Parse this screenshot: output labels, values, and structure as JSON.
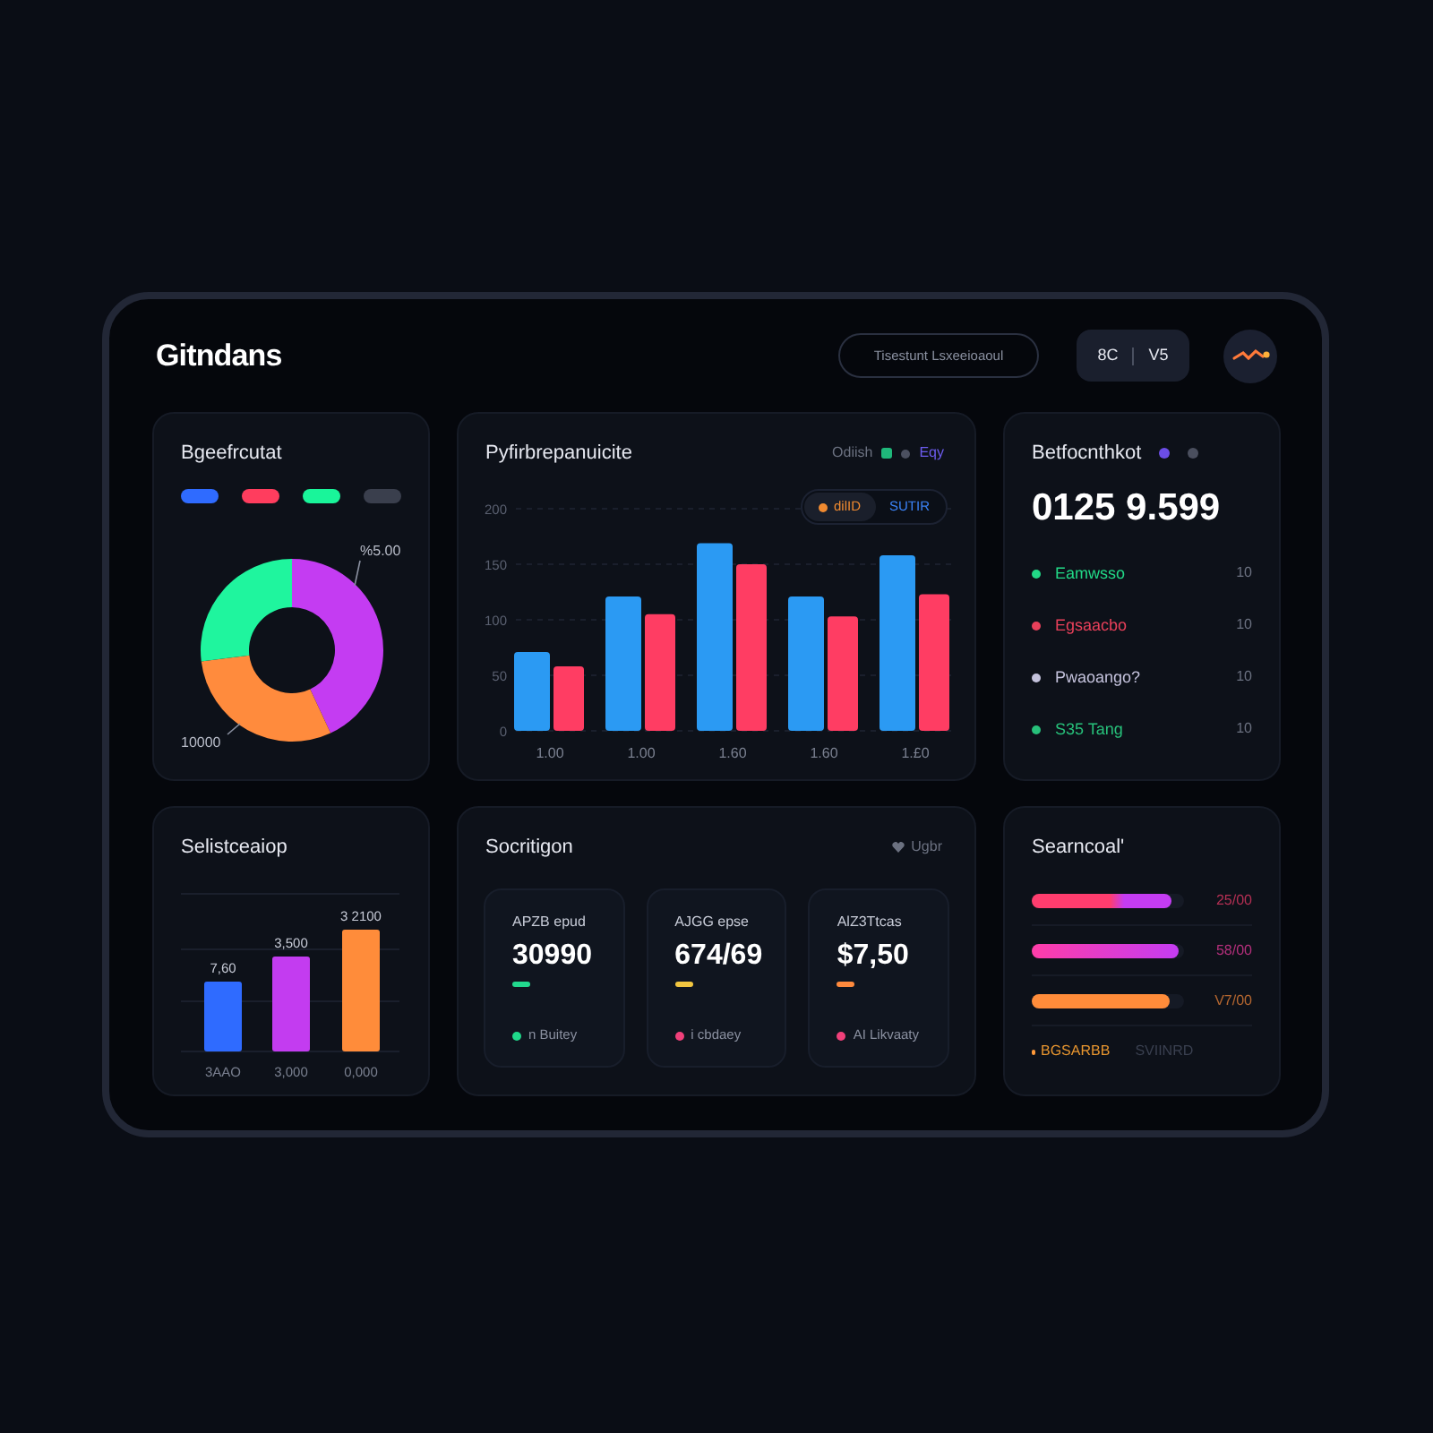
{
  "header": {
    "logo": "Gitndans",
    "search": {
      "placeholder": "Tisestunt Lsxeeioaoul"
    },
    "toggles": [
      {
        "label": "8C"
      },
      {
        "label": "V5"
      }
    ]
  },
  "donut_card": {
    "title": "Bgeefrcutat",
    "legend": [
      {
        "color": "#2f6bff"
      },
      {
        "color": "#ff3d5e"
      },
      {
        "color": "#19f59a"
      },
      {
        "color": "#3a3f4d"
      }
    ],
    "labels": [
      "%5.00",
      "10000"
    ]
  },
  "bar_card": {
    "title": "Pyfirbrepanuicite",
    "header_items": [
      {
        "kind": "text",
        "text": "Odiish",
        "color": "#6b7180"
      },
      {
        "kind": "swatch",
        "color": "#1fb87a"
      },
      {
        "kind": "dot",
        "color": "#4b5060"
      },
      {
        "kind": "text",
        "text": "Eqy",
        "color": "#6d5cf0"
      }
    ],
    "segments": [
      {
        "label": "dilID",
        "selected": true,
        "color": "#f08a30"
      },
      {
        "label": "SUTIR",
        "selected": false,
        "color": "#3b82f6"
      }
    ],
    "chart_data": {
      "type": "bar",
      "categories": [
        "1.00",
        "1.00",
        "1.60",
        "1.60",
        "1.£0"
      ],
      "series": [
        {
          "color": "#2b9af3",
          "values": [
            71,
            121,
            169,
            121,
            158
          ]
        },
        {
          "color": "#ff3d63",
          "values": [
            58,
            105,
            150,
            103,
            123
          ]
        }
      ],
      "ylim": [
        0,
        200
      ],
      "yticks": [
        0,
        50,
        100,
        150,
        200
      ],
      "grid": true
    }
  },
  "total_card": {
    "title": "Betfocnthkot",
    "title_dots": [
      {
        "color": "#6b4de6"
      },
      {
        "color": "#4a4f5e"
      }
    ],
    "value": "0125 9.599",
    "rows": [
      {
        "label": "Eamwsso",
        "value": "10",
        "color": "#22d987"
      },
      {
        "label": "Egsaacbo",
        "value": "10",
        "color": "#e8405a"
      },
      {
        "label": "Pwaoango?",
        "value": "10",
        "color": "#c4c2dc"
      },
      {
        "label": "S35 Tang",
        "value": "10",
        "color": "#27c07a"
      }
    ]
  },
  "column_card": {
    "title": "Selistceaiop",
    "bars": [
      {
        "value_label": "7,60",
        "label": "3AAO",
        "color": "#2f6bff"
      },
      {
        "value_label": "3,500",
        "label": "3,000",
        "color": "#c33cf0"
      },
      {
        "value_label": "3 2100",
        "label": "0,000",
        "color": "#ff8c3a"
      }
    ]
  },
  "stats_card": {
    "title": "Socritigon",
    "badge": "Ugbr",
    "items": [
      {
        "label": "APZB epud",
        "value": "30990",
        "marker": {
          "color": "#22d98e"
        },
        "footer": {
          "text": "n Buitey",
          "color": "#1fd98a"
        }
      },
      {
        "label": "AJGG epse",
        "value": "674/69",
        "marker": {
          "color": "#f2c640"
        },
        "footer": {
          "text": "i cbdaey",
          "color": "#f0407a"
        }
      },
      {
        "label": "AlZ3Ttcas",
        "value": "$7,50",
        "marker": {
          "color": "#ff8a3d"
        },
        "footer": {
          "text": "AI Likvaaty",
          "color": "#f0407a"
        }
      }
    ]
  },
  "progress_card": {
    "title": "Searncoal'",
    "bars": [
      {
        "kind": "split",
        "color": "#ff3d6e",
        "level": 0.92,
        "reading": "25/00"
      },
      {
        "kind": "gradient",
        "color": "#ff3da8",
        "level": 0.97,
        "reading": "58/00"
      },
      {
        "kind": "solid",
        "color": "#ff8c3a",
        "level": 0.91,
        "reading": "V7/00"
      }
    ],
    "footer": {
      "tag": "BGSARBB",
      "note": "SVIINRD"
    }
  }
}
